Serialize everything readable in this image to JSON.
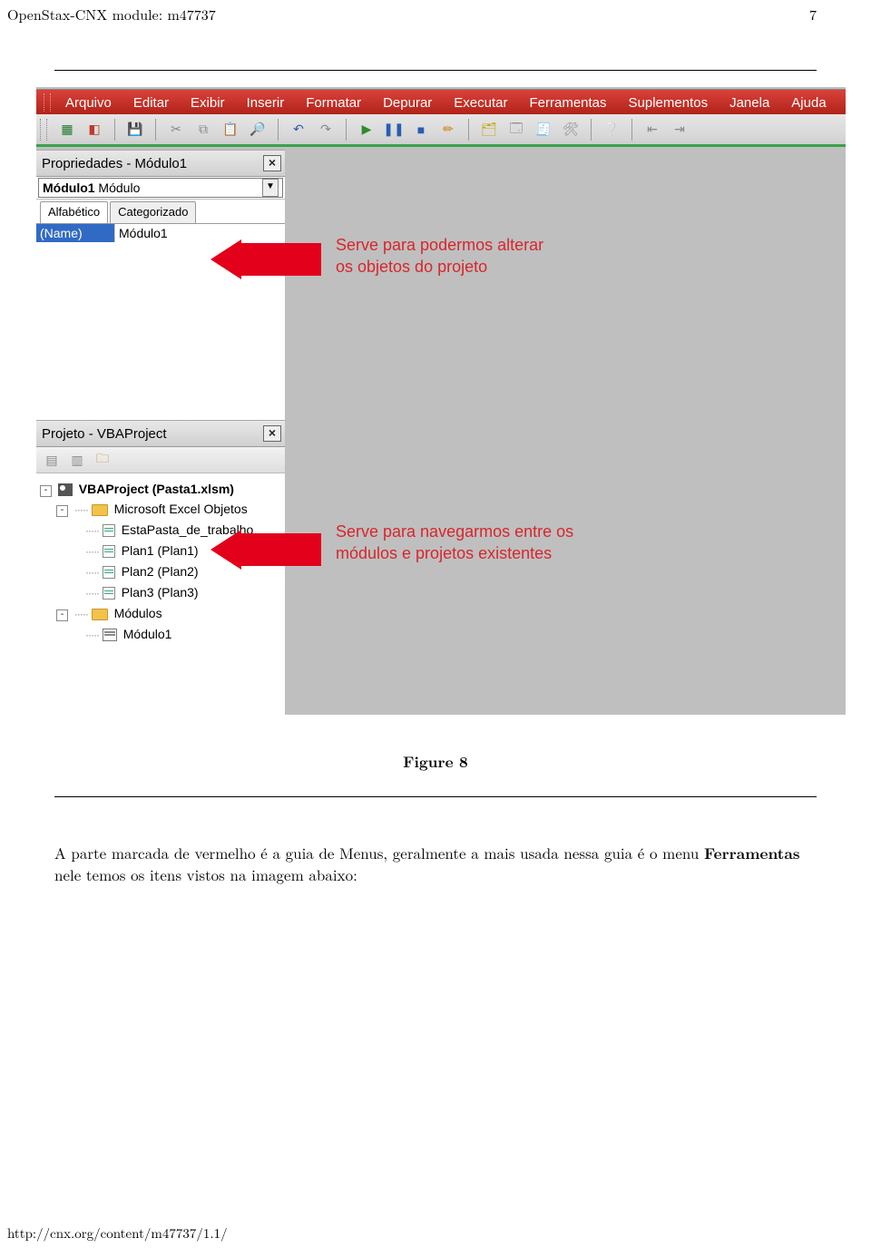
{
  "doc": {
    "header_left": "OpenStax-CNX module: m47737",
    "header_right": "7",
    "figure_caption": "Figure 8",
    "body_text_1": "A parte marcada de vermelho é a guia de Menus, geralmente a mais usada nessa guia é o menu ",
    "body_text_bold": "Ferra­mentas",
    "body_text_2": " nele temos os itens vistos na imagem abaixo:",
    "footer": "http://cnx.org/content/m47737/1.1/"
  },
  "menubar": {
    "items": [
      "Arquivo",
      "Editar",
      "Exibir",
      "Inserir",
      "Formatar",
      "Depurar",
      "Executar",
      "Ferramentas",
      "Suplementos",
      "Janela",
      "Ajuda"
    ]
  },
  "panels": {
    "properties": {
      "title": "Propriedades - Módulo1",
      "dropdown_bold": "Módulo1",
      "dropdown_rest": " Módulo",
      "tabs": [
        "Alfabético",
        "Categorizado"
      ],
      "prop_key": "(Name)",
      "prop_val": "Módulo1"
    },
    "project": {
      "title": "Projeto - VBAProject",
      "root": "VBAProject (Pasta1.xlsm)",
      "excel_objs": "Microsoft Excel Objetos",
      "sheets": [
        "EstaPasta_de_trabalho",
        "Plan1 (Plan1)",
        "Plan2 (Plan2)",
        "Plan3 (Plan3)"
      ],
      "modules_folder": "Módulos",
      "module1": "Módulo1"
    }
  },
  "annotations": {
    "a1_l1": "Serve para podermos alterar",
    "a1_l2": "os objetos do projeto",
    "a2_l1": "Serve para navegarmos  entre os",
    "a2_l2": "módulos e projetos existentes"
  }
}
